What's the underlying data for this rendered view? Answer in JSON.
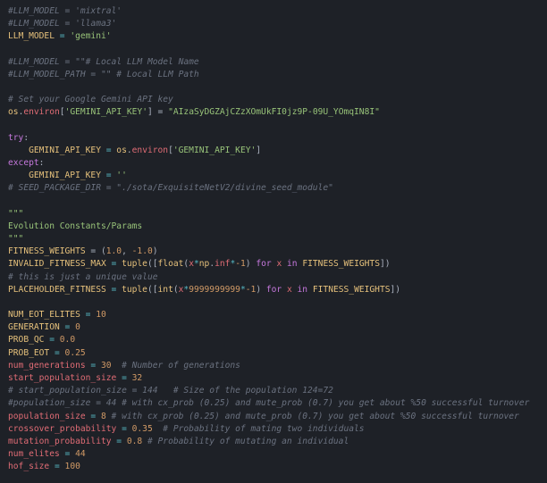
{
  "editor": {
    "lines": [
      [
        {
          "t": "#LLM_MODEL = 'mixtral'",
          "c": "c"
        }
      ],
      [
        {
          "t": "#LLM_MODEL = 'llama3'",
          "c": "c"
        }
      ],
      [
        {
          "t": "LLM_MODEL",
          "c": "v"
        },
        {
          "t": " = ",
          "c": "o"
        },
        {
          "t": "'gemini'",
          "c": "s"
        }
      ],
      [],
      [
        {
          "t": "#LLM_MODEL = \"\"# Local LLM Model Name",
          "c": "c"
        }
      ],
      [
        {
          "t": "#LLM_MODEL_PATH = \"\" # Local LLM Path",
          "c": "c"
        }
      ],
      [],
      [
        {
          "t": "# Set your Google Gemini API key",
          "c": "c"
        }
      ],
      [
        {
          "t": "os",
          "c": "v"
        },
        {
          "t": ".",
          "c": "t"
        },
        {
          "t": "environ",
          "c": "r"
        },
        {
          "t": "[",
          "c": "t"
        },
        {
          "t": "'GEMINI_API_KEY'",
          "c": "s"
        },
        {
          "t": "] = ",
          "c": "t"
        },
        {
          "t": "\"AIzaSyDGZAjCZzXOmUkFI0jz9P-09U_YOmqIN8I\"",
          "c": "s"
        }
      ],
      [],
      [
        {
          "t": "try",
          "c": "k"
        },
        {
          "t": ":",
          "c": "t"
        }
      ],
      [
        {
          "t": "    GEMINI_API_KEY",
          "c": "v"
        },
        {
          "t": " = ",
          "c": "o"
        },
        {
          "t": "os",
          "c": "v"
        },
        {
          "t": ".",
          "c": "t"
        },
        {
          "t": "environ",
          "c": "r"
        },
        {
          "t": "[",
          "c": "t"
        },
        {
          "t": "'GEMINI_API_KEY'",
          "c": "s"
        },
        {
          "t": "]",
          "c": "t"
        }
      ],
      [
        {
          "t": "except",
          "c": "k"
        },
        {
          "t": ":",
          "c": "t"
        }
      ],
      [
        {
          "t": "    GEMINI_API_KEY",
          "c": "v"
        },
        {
          "t": " = ",
          "c": "o"
        },
        {
          "t": "''",
          "c": "s"
        }
      ],
      [
        {
          "t": "# SEED_PACKAGE_DIR = \"./sota/ExquisiteNetV2/divine_seed_module\"",
          "c": "c"
        }
      ],
      [],
      [
        {
          "t": "\"\"\"",
          "c": "s"
        }
      ],
      [
        {
          "t": "Evolution Constants/Params",
          "c": "s"
        }
      ],
      [
        {
          "t": "\"\"\"",
          "c": "s"
        }
      ],
      [
        {
          "t": "FITNESS_WEIGHTS",
          "c": "v"
        },
        {
          "t": " = (",
          "c": "t"
        },
        {
          "t": "1.0",
          "c": "n"
        },
        {
          "t": ", ",
          "c": "t"
        },
        {
          "t": "-1.0",
          "c": "n"
        },
        {
          "t": ")",
          "c": "t"
        }
      ],
      [
        {
          "t": "INVALID_FITNESS_MAX",
          "c": "v"
        },
        {
          "t": " = ",
          "c": "o"
        },
        {
          "t": "tuple",
          "c": "v"
        },
        {
          "t": "([",
          "c": "t"
        },
        {
          "t": "float",
          "c": "v"
        },
        {
          "t": "(",
          "c": "t"
        },
        {
          "t": "x",
          "c": "r"
        },
        {
          "t": "*",
          "c": "o"
        },
        {
          "t": "np",
          "c": "v"
        },
        {
          "t": ".",
          "c": "t"
        },
        {
          "t": "inf",
          "c": "r"
        },
        {
          "t": "*",
          "c": "o"
        },
        {
          "t": "-1",
          "c": "n"
        },
        {
          "t": ") ",
          "c": "t"
        },
        {
          "t": "for",
          "c": "k"
        },
        {
          "t": " x ",
          "c": "r"
        },
        {
          "t": "in",
          "c": "k"
        },
        {
          "t": " FITNESS_WEIGHTS",
          "c": "v"
        },
        {
          "t": "])",
          "c": "t"
        }
      ],
      [
        {
          "t": "# this is just a unique value",
          "c": "c"
        }
      ],
      [
        {
          "t": "PLACEHOLDER_FITNESS",
          "c": "v"
        },
        {
          "t": " = ",
          "c": "o"
        },
        {
          "t": "tuple",
          "c": "v"
        },
        {
          "t": "([",
          "c": "t"
        },
        {
          "t": "int",
          "c": "v"
        },
        {
          "t": "(",
          "c": "t"
        },
        {
          "t": "x",
          "c": "r"
        },
        {
          "t": "*",
          "c": "o"
        },
        {
          "t": "9999999999",
          "c": "n"
        },
        {
          "t": "*",
          "c": "o"
        },
        {
          "t": "-1",
          "c": "n"
        },
        {
          "t": ") ",
          "c": "t"
        },
        {
          "t": "for",
          "c": "k"
        },
        {
          "t": " x ",
          "c": "r"
        },
        {
          "t": "in",
          "c": "k"
        },
        {
          "t": " FITNESS_WEIGHTS",
          "c": "v"
        },
        {
          "t": "])",
          "c": "t"
        }
      ],
      [],
      [
        {
          "t": "NUM_EOT_ELITES",
          "c": "v"
        },
        {
          "t": " = ",
          "c": "o"
        },
        {
          "t": "10",
          "c": "n"
        }
      ],
      [
        {
          "t": "GENERATION",
          "c": "v"
        },
        {
          "t": " = ",
          "c": "o"
        },
        {
          "t": "0",
          "c": "n"
        }
      ],
      [
        {
          "t": "PROB_QC",
          "c": "v"
        },
        {
          "t": " = ",
          "c": "o"
        },
        {
          "t": "0.0",
          "c": "n"
        }
      ],
      [
        {
          "t": "PROB_EOT",
          "c": "v"
        },
        {
          "t": " = ",
          "c": "o"
        },
        {
          "t": "0.25",
          "c": "n"
        }
      ],
      [
        {
          "t": "num_generations",
          "c": "r"
        },
        {
          "t": " = ",
          "c": "o"
        },
        {
          "t": "30",
          "c": "n"
        },
        {
          "t": "  # Number of generations",
          "c": "c"
        }
      ],
      [
        {
          "t": "start_population_size",
          "c": "r"
        },
        {
          "t": " = ",
          "c": "o"
        },
        {
          "t": "32",
          "c": "n"
        }
      ],
      [
        {
          "t": "# start_population_size = 144   # Size of the population 124=72",
          "c": "c"
        }
      ],
      [
        {
          "t": "#population_size = 44 # with cx_prob (0.25) and mute_prob (0.7) you get about %50 successful turnover",
          "c": "c"
        }
      ],
      [
        {
          "t": "population_size",
          "c": "r"
        },
        {
          "t": " = ",
          "c": "o"
        },
        {
          "t": "8",
          "c": "n"
        },
        {
          "t": " # with cx_prob (0.25) and mute_prob (0.7) you get about %50 successful turnover",
          "c": "c"
        }
      ],
      [
        {
          "t": "crossover_probability",
          "c": "r"
        },
        {
          "t": " = ",
          "c": "o"
        },
        {
          "t": "0.35",
          "c": "n"
        },
        {
          "t": "  # Probability of mating two individuals",
          "c": "c"
        }
      ],
      [
        {
          "t": "mutation_probability",
          "c": "r"
        },
        {
          "t": " = ",
          "c": "o"
        },
        {
          "t": "0.8",
          "c": "n"
        },
        {
          "t": " # Probability of mutating an individual",
          "c": "c"
        }
      ],
      [
        {
          "t": "num_elites",
          "c": "r"
        },
        {
          "t": " = ",
          "c": "o"
        },
        {
          "t": "44",
          "c": "n"
        }
      ],
      [
        {
          "t": "hof_size",
          "c": "r"
        },
        {
          "t": " = ",
          "c": "o"
        },
        {
          "t": "100",
          "c": "n"
        }
      ]
    ]
  },
  "colors": {
    "background": "#1e2127",
    "comment": "#6b7280",
    "keyword": "#c678dd",
    "string": "#98c379",
    "number": "#d19a66",
    "constant": "#e5c07b",
    "variable": "#e06c75",
    "operator": "#56b6c2",
    "text": "#abb2bf"
  }
}
